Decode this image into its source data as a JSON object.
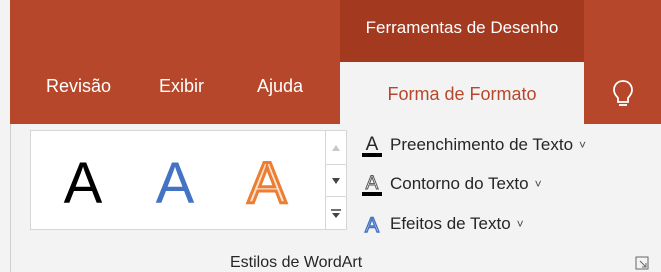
{
  "contextual": {
    "title": "Ferramentas de Desenho"
  },
  "tabs": [
    {
      "label": "Revisão"
    },
    {
      "label": "Exibir"
    },
    {
      "label": "Ajuda"
    },
    {
      "label": "Forma de Formato",
      "active": true
    }
  ],
  "tell_me": {
    "icon": "lightbulb-icon"
  },
  "wordart_gallery": {
    "items": [
      {
        "glyph": "A",
        "style": "black-fill",
        "color": "#000000"
      },
      {
        "glyph": "A",
        "style": "blue-fill",
        "color": "#4472c4"
      },
      {
        "glyph": "A",
        "style": "orange-outline-glow",
        "color": "#ed7d31"
      }
    ]
  },
  "commands": [
    {
      "label": "Preenchimento de Texto",
      "chevron": "˅",
      "icon": "text-fill-icon"
    },
    {
      "label": "Contorno do Texto",
      "chevron": "˅",
      "icon": "text-outline-icon"
    },
    {
      "label": "Efeitos de Texto",
      "chevron": "˅",
      "icon": "text-effects-icon"
    }
  ],
  "group": {
    "label": "Estilos de WordArt"
  },
  "colors": {
    "accent": "#b7472a",
    "context": "#a33a20"
  }
}
